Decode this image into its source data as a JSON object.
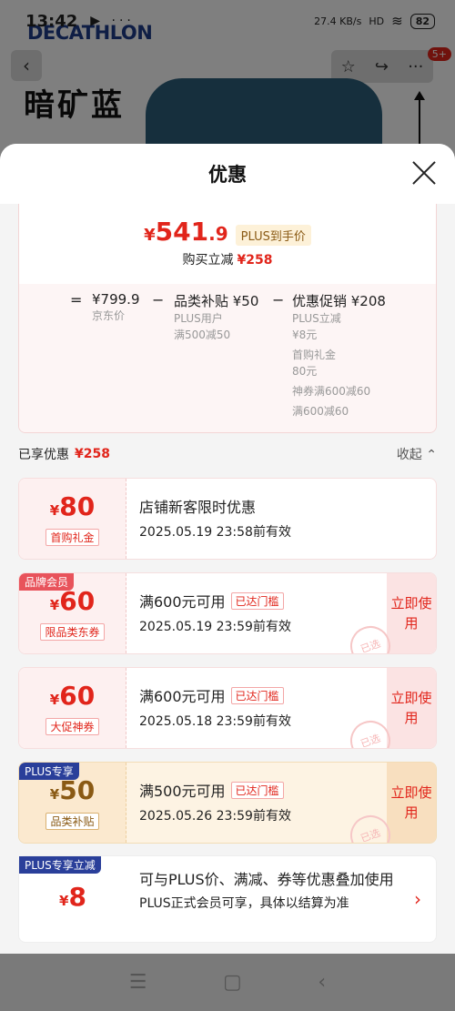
{
  "status_bar": {
    "time": "13:42",
    "icons": "▶ ···",
    "net_speed": "27.4 KB/s",
    "signal": "HD",
    "battery": "82"
  },
  "background": {
    "brand": "DECATHLON",
    "product_title": "暗矿蓝",
    "notify_badge": "5+"
  },
  "sheet": {
    "title": "优惠"
  },
  "price": {
    "currency": "¥",
    "integer": "541",
    "decimal": ".9",
    "plus_tag": "PLUS到手价",
    "reduce_label": "购买立减",
    "reduce_amount": "¥258",
    "breakdown": {
      "eq": "=",
      "minus1": "−",
      "minus2": "−",
      "base": {
        "main": "¥799.9",
        "sub": [
          "京东价"
        ]
      },
      "cat": {
        "main": "品类补贴 ¥50",
        "sub": [
          "PLUS用户",
          "满500减50"
        ]
      },
      "promo": {
        "main": "优惠促销 ¥208",
        "sub": [
          "PLUS立减",
          "¥8元",
          "首购礼金",
          "80元",
          "神券满600减60",
          "满600减60"
        ]
      }
    }
  },
  "enjoyed": {
    "label": "已享优惠",
    "amount": "¥258",
    "toggle": "收起 ⌃"
  },
  "coupons": [
    {
      "amount_cur": "¥",
      "amount": "80",
      "type": "首购礼金",
      "corner": "",
      "title": "店铺新客限时优惠",
      "reached": "",
      "validity": "2025.05.19 23:58前有效",
      "btn": ""
    },
    {
      "amount_cur": "¥",
      "amount": "60",
      "type": "限品类东券",
      "corner": "品牌会员",
      "title": "满600元可用",
      "reached": "已达门槛",
      "validity": "2025.05.19 23:59前有效",
      "btn": "立即使用",
      "stamp": "已选"
    },
    {
      "amount_cur": "¥",
      "amount": "60",
      "type": "大促神券",
      "corner": "",
      "title": "满600元可用",
      "reached": "已达门槛",
      "validity": "2025.05.18 23:59前有效",
      "btn": "立即使用",
      "stamp": "已选"
    },
    {
      "amount_cur": "¥",
      "amount": "50",
      "type": "品类补贴",
      "corner": "PLUS专享",
      "title": "满500元可用",
      "reached": "已达门槛",
      "validity": "2025.05.26 23:59前有效",
      "btn": "立即使用",
      "stamp": "已选"
    }
  ],
  "plus_card": {
    "corner": "PLUS专享立减",
    "amount_cur": "¥",
    "amount": "8",
    "title": "可与PLUS价、满减、券等优惠叠加使用",
    "note": "PLUS正式会员可享，具体以结算为准",
    "chevron": "›"
  },
  "nav": {
    "menu": "☰",
    "home": "▢",
    "back": "‹"
  }
}
